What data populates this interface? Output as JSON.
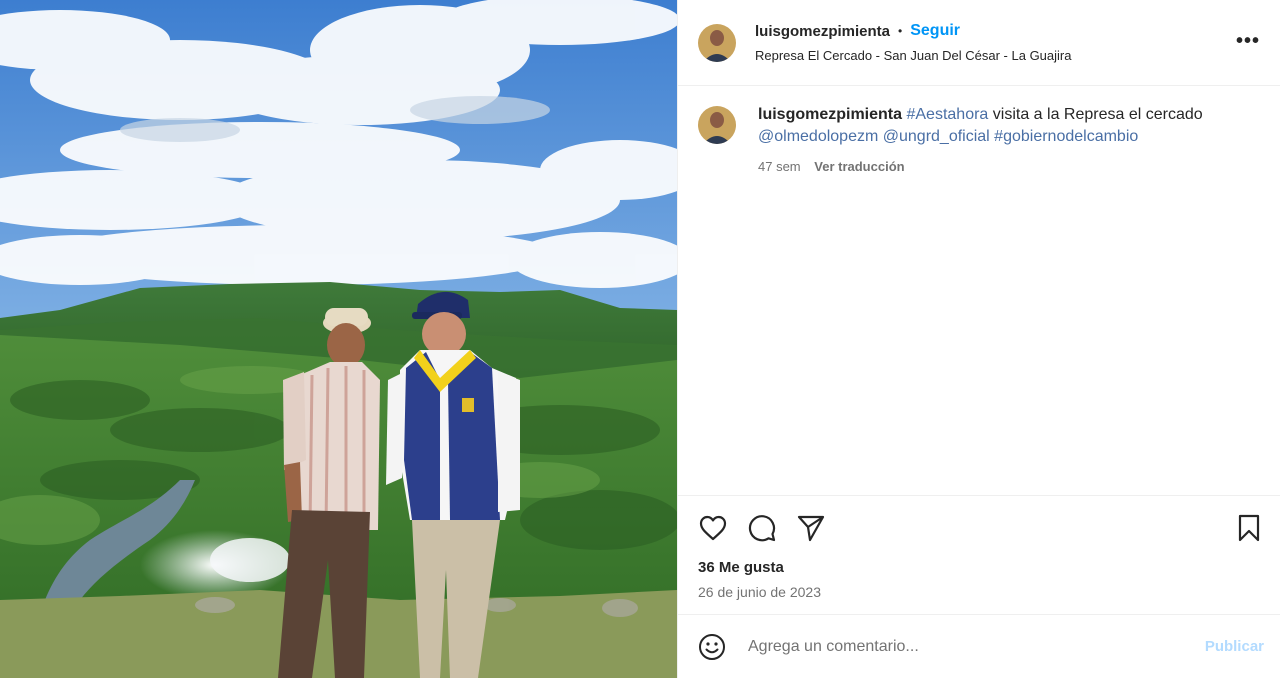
{
  "post": {
    "image_alt": "Dos hombres frente a la Represa El Cercado",
    "author": {
      "username": "luisgomezpimienta",
      "follow_label": "Seguir",
      "separator": "•",
      "location": "Represa El Cercado - San Juan Del César - La Guajira"
    },
    "more_icon": "more-options-icon",
    "caption": {
      "username": "luisgomezpimienta",
      "hashtag1": "#Aestahora",
      "text1": " visita a la Represa el cercado",
      "mention1": "@olmedolopezm",
      "mention2": "@ungrd_oficial",
      "hashtag2": "#gobiernodelcambio",
      "age": "47 sem",
      "translate": "Ver traducción"
    },
    "actions": {
      "like_icon": "heart-icon",
      "comment_icon": "comment-icon",
      "share_icon": "share-icon",
      "save_icon": "bookmark-icon"
    },
    "likes": "36 Me gusta",
    "date": "26 de junio de 2023",
    "composer": {
      "placeholder": "Agrega un comentario...",
      "publish_label": "Publicar",
      "emoji_icon": "emoji-icon"
    }
  },
  "colors": {
    "accent": "#0095f6",
    "link": "#4a6fa5",
    "muted": "#737373",
    "publish_disabled": "#b3dbff"
  }
}
